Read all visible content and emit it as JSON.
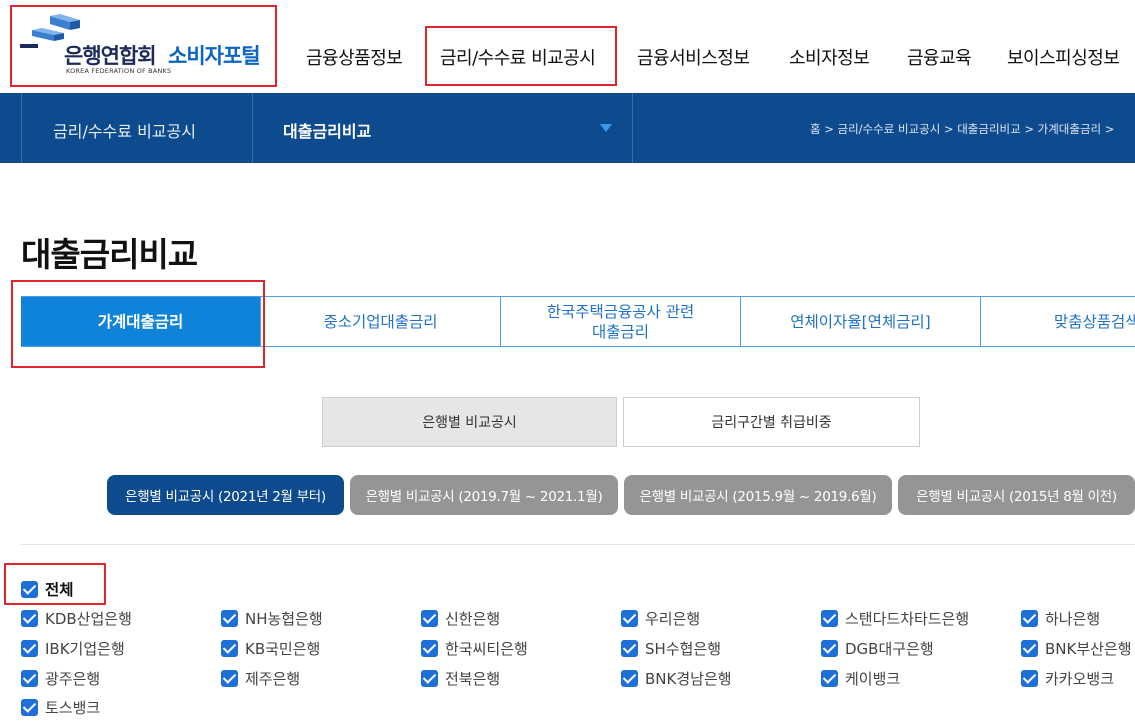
{
  "header": {
    "logo_org": "은행연합회",
    "logo_service": "소비자포털",
    "logo_eng": "KOREA FEDERATION OF BANKS",
    "gnb": [
      "금융상품정보",
      "금리/수수료 비교공시",
      "금융서비스정보",
      "소비자정보",
      "금융교육",
      "보이스피싱정보"
    ]
  },
  "navbar": {
    "section": "금리/수수료 비교공시",
    "current": "대출금리비교",
    "breadcrumb": "홈 > 금리/수수료 비교공시 > 대출금리비교 > 가계대출금리 >"
  },
  "page": {
    "title": "대출금리비교"
  },
  "tabs": [
    {
      "label": "가계대출금리",
      "active": true
    },
    {
      "label": "중소기업대출금리",
      "active": false
    },
    {
      "label_line1": "한국주택금융공사 관련",
      "label_line2": "대출금리",
      "active": false
    },
    {
      "label": "연체이자율[연체금리]",
      "active": false
    },
    {
      "label": "맞춤상품검색",
      "active": false
    }
  ],
  "subtabs": [
    {
      "label": "은행별 비교공시",
      "active": true
    },
    {
      "label": "금리구간별 취급비중",
      "active": false
    }
  ],
  "periods": [
    {
      "label": "은행별 비교공시 (2021년 2월 부터)",
      "active": true
    },
    {
      "label": "은행별 비교공시 (2019.7월 ~ 2021.1월)",
      "active": false
    },
    {
      "label": "은행별 비교공시 (2015.9월 ~ 2019.6월)",
      "active": false
    },
    {
      "label": "은행별 비교공시 (2015년 8월 이전)",
      "active": false
    }
  ],
  "banks": {
    "all_label": "전체",
    "list": [
      "KDB산업은행",
      "NH농협은행",
      "신한은행",
      "우리은행",
      "스탠다드차타드은행",
      "하나은행",
      "IBK기업은행",
      "KB국민은행",
      "한국씨티은행",
      "SH수협은행",
      "DGB대구은행",
      "BNK부산은행",
      "광주은행",
      "제주은행",
      "전북은행",
      "BNK경남은행",
      "케이뱅크",
      "카카오뱅크",
      "토스뱅크"
    ]
  },
  "colors": {
    "navbar": "#0d4a8e",
    "tab_active": "#0f83d9",
    "checkbox": "#1e6fd8",
    "highlight": "#e0262d"
  }
}
